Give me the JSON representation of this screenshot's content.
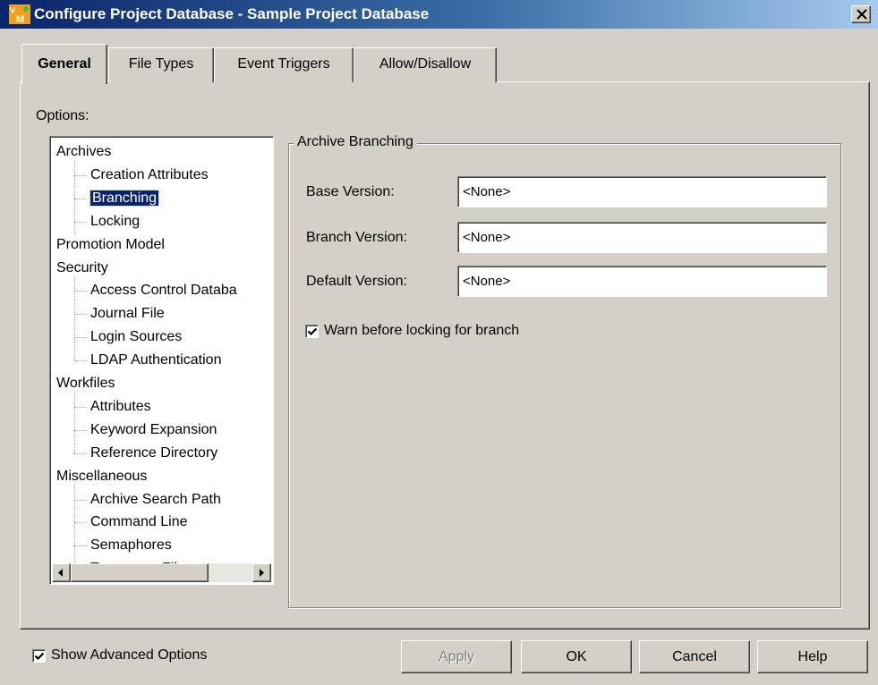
{
  "window": {
    "title": "Configure Project Database - Sample Project Database",
    "app_icon": "vm-app-icon",
    "close_icon": "close-icon"
  },
  "tabs": [
    {
      "label": "General",
      "active": true
    },
    {
      "label": "File Types",
      "active": false
    },
    {
      "label": "Event Triggers",
      "active": false
    },
    {
      "label": "Allow/Disallow",
      "active": false
    }
  ],
  "options": {
    "label": "Options:",
    "tree": [
      {
        "label": "Archives",
        "level": 0
      },
      {
        "label": "Creation Attributes",
        "level": 1
      },
      {
        "label": "Branching",
        "level": 1,
        "selected": true
      },
      {
        "label": "Locking",
        "level": 1
      },
      {
        "label": "Promotion Model",
        "level": 0
      },
      {
        "label": "Security",
        "level": 0
      },
      {
        "label": "Access Control Databa",
        "level": 1
      },
      {
        "label": "Journal File",
        "level": 1
      },
      {
        "label": "Login Sources",
        "level": 1
      },
      {
        "label": "LDAP Authentication",
        "level": 1
      },
      {
        "label": "Workfiles",
        "level": 0
      },
      {
        "label": "Attributes",
        "level": 1
      },
      {
        "label": "Keyword Expansion",
        "level": 1
      },
      {
        "label": "Reference Directory",
        "level": 1
      },
      {
        "label": "Miscellaneous",
        "level": 0
      },
      {
        "label": "Archive Search Path",
        "level": 1
      },
      {
        "label": "Command Line",
        "level": 1
      },
      {
        "label": "Semaphores",
        "level": 1
      },
      {
        "label": "Temporary Files",
        "level": 1
      }
    ]
  },
  "archive_branching": {
    "title": "Archive Branching",
    "base_version": {
      "label": "Base Version:",
      "value": "<None>"
    },
    "branch_version": {
      "label": "Branch Version:",
      "value": "<None>"
    },
    "default_version": {
      "label": "Default Version:",
      "value": "<None>"
    },
    "warn_checkbox": {
      "label": "Warn before locking for branch",
      "checked": true
    }
  },
  "footer": {
    "show_advanced": {
      "label": "Show Advanced Options",
      "checked": true
    },
    "apply_label": "Apply",
    "apply_enabled": false,
    "ok_label": "OK",
    "cancel_label": "Cancel",
    "help_label": "Help"
  },
  "colors": {
    "title_gradient_start": "#0a246a",
    "title_gradient_end": "#a6caf0",
    "selection": "#0a246a",
    "face": "#d4d0c8"
  }
}
